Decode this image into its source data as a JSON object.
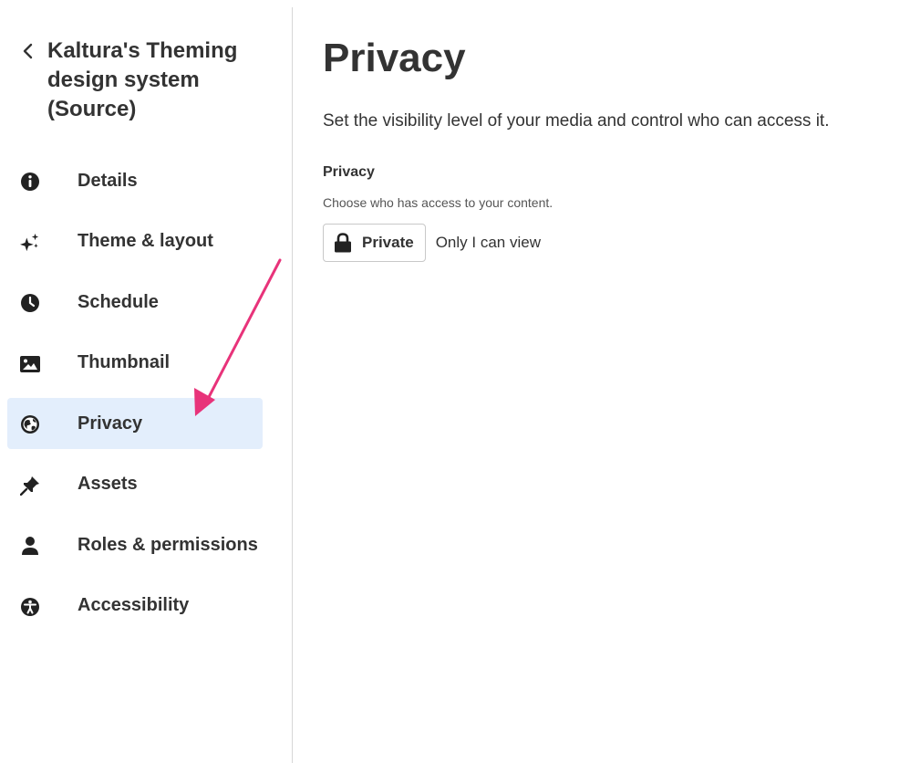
{
  "sidebar": {
    "back_icon": "chevron-left-icon",
    "title": "Kaltura's Theming design system (Source)",
    "items": [
      {
        "label": "Details",
        "icon": "info-circle-icon",
        "active": false
      },
      {
        "label": "Theme & layout",
        "icon": "sparkles-icon",
        "active": false
      },
      {
        "label": "Schedule",
        "icon": "clock-icon",
        "active": false
      },
      {
        "label": "Thumbnail",
        "icon": "image-icon",
        "active": false
      },
      {
        "label": "Privacy",
        "icon": "globe-icon",
        "active": true
      },
      {
        "label": "Assets",
        "icon": "pin-icon",
        "active": false
      },
      {
        "label": "Roles & permissions",
        "icon": "user-icon",
        "active": false
      },
      {
        "label": "Accessibility",
        "icon": "accessibility-icon",
        "active": false
      }
    ]
  },
  "main": {
    "title": "Privacy",
    "subtitle": "Set the visibility level of your media and control who can access it.",
    "privacy": {
      "label": "Privacy",
      "help": "Choose who has access to your content.",
      "button_label": "Private",
      "button_icon": "lock-icon",
      "description": "Only I can view"
    }
  },
  "annotation": {
    "arrow_color": "#e8337a"
  },
  "colors": {
    "active_item_bg": "#e3eefc",
    "text": "#333333"
  }
}
